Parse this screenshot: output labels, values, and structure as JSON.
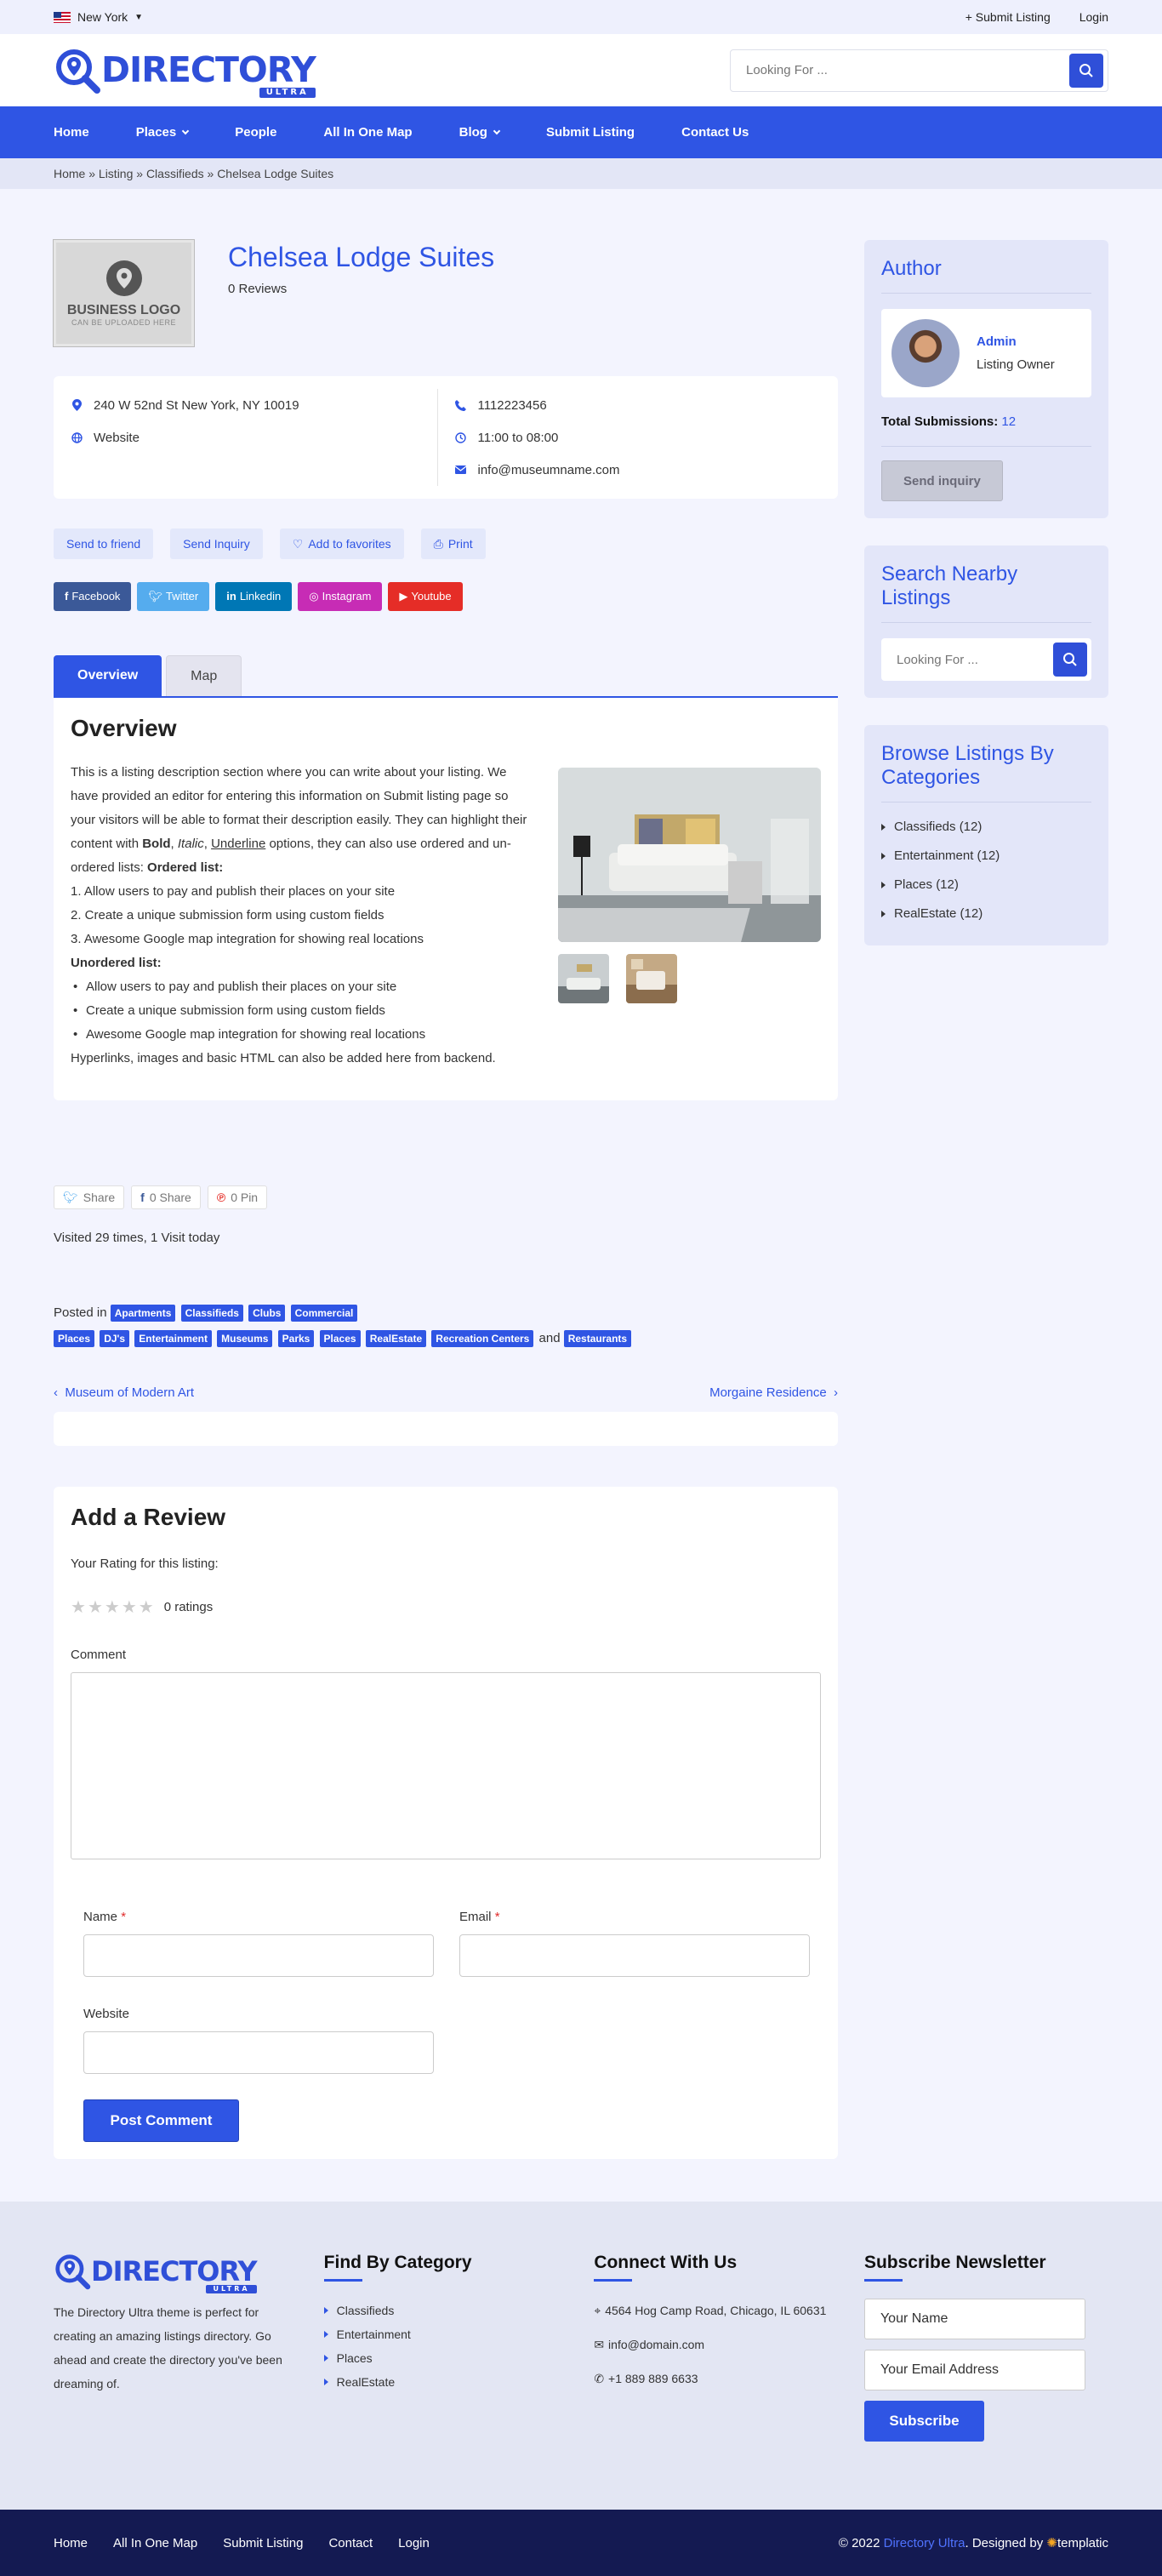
{
  "topbar": {
    "city": "New York",
    "submit": "+ Submit Listing",
    "login": "Login"
  },
  "header": {
    "logo": "DIRECTORY",
    "logo_badge": "ULTRA",
    "search_placeholder": "Looking For ..."
  },
  "nav": [
    {
      "label": "Home"
    },
    {
      "label": "Places",
      "dropdown": true
    },
    {
      "label": "People"
    },
    {
      "label": "All In One Map"
    },
    {
      "label": "Blog",
      "dropdown": true
    },
    {
      "label": "Submit Listing"
    },
    {
      "label": "Contact Us"
    }
  ],
  "breadcrumb": "Home » Listing » Classifieds » Chelsea Lodge Suites",
  "listing": {
    "logo_title": "BUSINESS LOGO",
    "logo_sub": "CAN BE UPLOADED HERE",
    "title": "Chelsea Lodge Suites",
    "reviews": "0 Reviews",
    "address": "240 W 52nd St New York, NY 10019",
    "website": "Website",
    "phone": "1112223456",
    "hours": "11:00 to 08:00",
    "email": "info@museumname.com"
  },
  "actions": {
    "send": "Send to friend",
    "inquiry": "Send Inquiry",
    "fav": "Add to favorites",
    "print": "Print"
  },
  "social": [
    {
      "label": "Facebook",
      "color": "#3b5998"
    },
    {
      "label": "Twitter",
      "color": "#55acee"
    },
    {
      "label": "Linkedin",
      "color": "#0077b5"
    },
    {
      "label": "Instagram",
      "color": "#c72cb5"
    },
    {
      "label": "Youtube",
      "color": "#e52d27"
    }
  ],
  "tabs": {
    "overview": "Overview",
    "map": "Map"
  },
  "overview": {
    "title": "Overview",
    "p1": "This is a listing description section where you can write about your listing. We have provided an editor for entering this information on Submit listing page so your visitors will be able to format their description easily. They can highlight their content with ",
    "bold": "Bold",
    "italic": "Italic",
    "underline": "Underline",
    "p1b": " options, they can also use ordered and un-ordered lists: ",
    "ordered_label": "Ordered list:",
    "ordered": [
      "1. Allow users to pay and publish their places on your site",
      "2. Create a unique submission form using custom fields",
      "3. Awesome Google map integration for showing real locations"
    ],
    "unordered_label": "Unordered list:",
    "unordered": [
      "Allow users to pay and publish their places on your site",
      "Create a unique submission form using custom fields",
      "Awesome Google map integration for showing real locations"
    ],
    "p2": "Hyperlinks, images and basic HTML can also be added here from backend."
  },
  "share": {
    "twitter": "Share",
    "facebook": "0 Share",
    "pinterest": "0 Pin"
  },
  "visits": "Visited 29 times, 1 Visit today",
  "posted": {
    "label": "Posted in",
    "tags1": [
      "Apartments",
      "Classifieds",
      "Clubs",
      "Commercial"
    ],
    "tags2": [
      "Places",
      "DJ's",
      "Entertainment",
      "Museums",
      "Parks",
      "Places",
      "RealEstate",
      "Recreation Centers"
    ],
    "and": "and",
    "last": "Restaurants"
  },
  "postnav": {
    "prev": "Museum of Modern Art",
    "next": "Morgaine Residence"
  },
  "review": {
    "title": "Add a Review",
    "rating_label": "Your Rating for this listing:",
    "ratings": "0 ratings",
    "comment": "Comment",
    "name": "Name",
    "email": "Email",
    "website": "Website",
    "submit": "Post Comment"
  },
  "sidebar": {
    "author_title": "Author",
    "author_name": "Admin",
    "author_role": "Listing Owner",
    "subs_label": "Total Submissions:",
    "subs_count": "12",
    "inquiry": "Send inquiry",
    "search_title": "Search Nearby Listings",
    "search_placeholder": "Looking For ...",
    "browse_title": "Browse Listings By Categories",
    "categories": [
      "Classifieds (12)",
      "Entertainment (12)",
      "Places (12)",
      "RealEstate (12)"
    ]
  },
  "footer": {
    "desc": "The Directory Ultra theme is perfect for creating an amazing listings directory. Go ahead and create the directory you've been dreaming of.",
    "cat_title": "Find By Category",
    "cats": [
      "Classifieds",
      "Entertainment",
      "Places",
      "RealEstate"
    ],
    "connect_title": "Connect With Us",
    "address": "4564 Hog Camp Road, Chicago, IL 60631",
    "email": "info@domain.com",
    "phone": "+1 889 889 6633",
    "news_title": "Subscribe Newsletter",
    "name_ph": "Your Name",
    "email_ph": "Your Email Address",
    "subscribe": "Subscribe"
  },
  "bottom": {
    "links": [
      "Home",
      "All In One Map",
      "Submit Listing",
      "Contact",
      "Login"
    ],
    "copy": "© 2022",
    "brand": "Directory Ultra",
    "designed": ". Designed by",
    "templatic": "templatic"
  }
}
